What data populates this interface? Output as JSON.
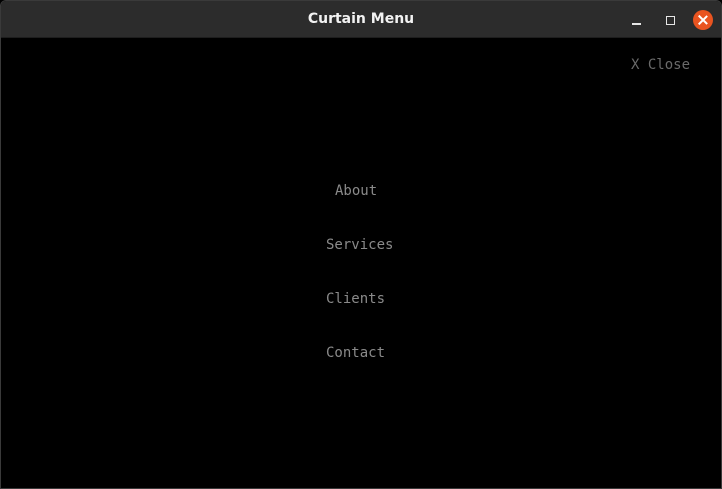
{
  "window": {
    "title": "Curtain Menu",
    "accent_color": "#e95420",
    "controls": [
      "minimize-icon",
      "maximize-icon",
      "close-icon"
    ]
  },
  "overlay": {
    "close_label": "X Close",
    "menu_items": [
      {
        "label": "About"
      },
      {
        "label": "Services"
      },
      {
        "label": "Clients"
      },
      {
        "label": "Contact"
      }
    ]
  }
}
